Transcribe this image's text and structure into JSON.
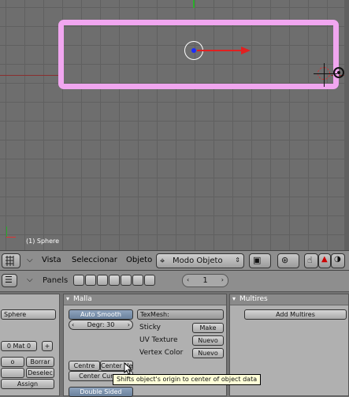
{
  "viewport": {
    "object_label": "(1) Sphere"
  },
  "header": {
    "menus": [
      "Vista",
      "Seleccionar",
      "Objeto"
    ],
    "mode": "Modo Objeto"
  },
  "buttons_header": {
    "panels_label": "Panels",
    "frame": "1"
  },
  "left_panel": {
    "object_name": "Sphere",
    "mat_field": "0 Mat 0",
    "buttons": [
      "o",
      "Borrar",
      "Deselec",
      "Assign"
    ],
    "mat_plus": "+"
  },
  "mesh_panel": {
    "title": "Malla",
    "auto_smooth": "Auto Smooth",
    "degr": "Degr: 30",
    "texmesh": "TexMesh:",
    "sticky_label": "Sticky",
    "sticky_btn": "Make",
    "uv_label": "UV Texture",
    "uv_btn": "Nuevo",
    "vcol_label": "Vertex Color",
    "vcol_btn": "Nuevo",
    "centre_label": "Centre",
    "centre_new": "Center New",
    "center_cursor": "Center Cursor",
    "double_sided": "Double Sided"
  },
  "multires_panel": {
    "title": "Multires",
    "add_btn": "Add Multires"
  },
  "tooltip": "Shifts object's origin to center of object data"
}
